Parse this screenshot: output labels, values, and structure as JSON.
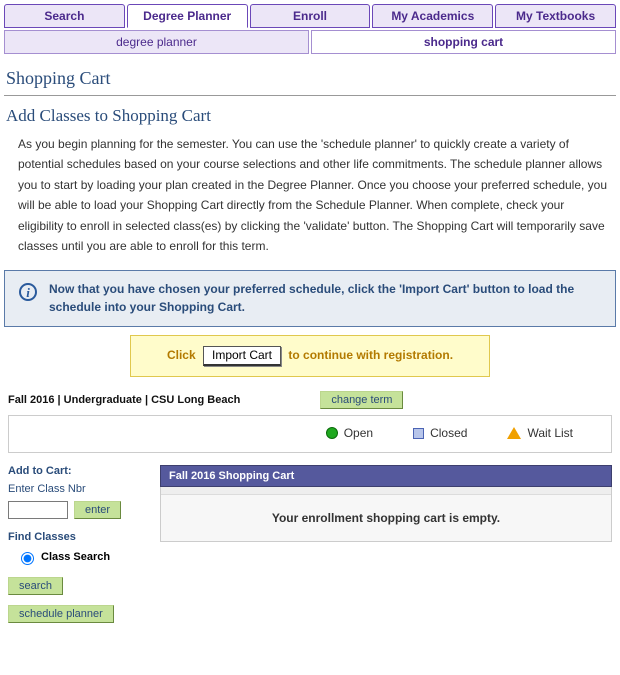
{
  "top_tabs": {
    "search": "Search",
    "degree_planner": "Degree Planner",
    "enroll": "Enroll",
    "my_academics": "My Academics",
    "my_textbooks": "My Textbooks"
  },
  "sub_tabs": {
    "degree_planner": "degree planner",
    "shopping_cart": "shopping cart"
  },
  "page_title": "Shopping Cart",
  "sub_title": "Add Classes to Shopping Cart",
  "body_text": "As you begin planning for the semester.  You can use the 'schedule planner' to quickly create a variety of potential schedules based on your course selections and other life commitments. The schedule planner allows you to start by loading your plan created in the Degree Planner. Once you choose your preferred schedule, you will be able to load your Shopping Cart directly from the Schedule Planner. When complete, check your eligibility to enroll in selected class(es) by clicking the 'validate' button. The Shopping Cart will temporarily save classes until you are able to enroll for this term.",
  "info_text": "Now that you have chosen your preferred schedule,  click the 'Import Cart' button to load the schedule into your Shopping Cart.",
  "callout": {
    "before": "Click",
    "button": "Import Cart",
    "after": "to continue with registration."
  },
  "term_label": "Fall 2016 | Undergraduate | CSU Long Beach",
  "buttons": {
    "change_term": "change term",
    "enter": "enter",
    "search": "search",
    "schedule_planner": "schedule planner"
  },
  "legend": {
    "open": "Open",
    "closed": "Closed",
    "wait": "Wait List"
  },
  "left": {
    "add_to_cart": "Add to Cart:",
    "enter_class_nbr": "Enter Class Nbr",
    "find_classes": "Find Classes",
    "class_search": "Class Search"
  },
  "cart": {
    "header": "Fall 2016 Shopping Cart",
    "empty": "Your enrollment shopping cart is empty."
  }
}
